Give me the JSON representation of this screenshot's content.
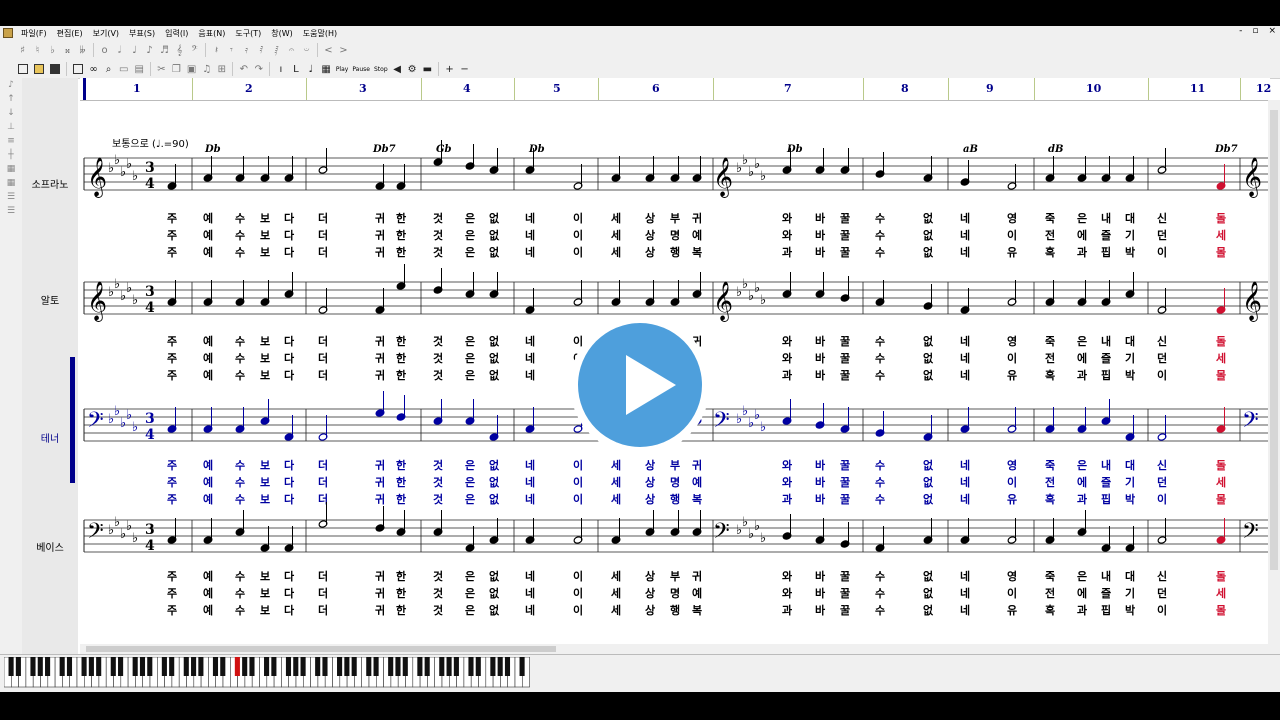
{
  "menu": [
    "파일(F)",
    "편집(E)",
    "보기(V)",
    "부표(S)",
    "입력(I)",
    "음표(N)",
    "도구(T)",
    "창(W)",
    "도움말(H)"
  ],
  "window_controls": [
    "-",
    "▫",
    "×"
  ],
  "toolbar1_icons": [
    "♯",
    "♮",
    "♭",
    "𝄪",
    "𝄫",
    "o",
    "𝅗𝅥",
    "♩",
    "♪",
    "♬",
    "𝄞",
    "𝄢",
    "𝄽",
    "𝄾",
    "𝄿",
    "𝅀",
    "𝅁",
    "𝄐",
    "𝄑",
    "<",
    ">"
  ],
  "toolbar2_icons": [
    "new-icon",
    "open-icon",
    "save-icon",
    "print-icon",
    "zoom-icon",
    "cut-icon",
    "copy-icon",
    "paste-icon",
    "undo-icon",
    "redo-icon"
  ],
  "transport": {
    "play": "Play",
    "pause": "Pause",
    "stop": "Stop"
  },
  "tempo_marking": "보통으로 (♩.=90)",
  "measures": [
    "1",
    "2",
    "3",
    "4",
    "5",
    "6",
    "7",
    "8",
    "9",
    "10",
    "11",
    "12"
  ],
  "chords": [
    {
      "label": "Db",
      "measure": 2
    },
    {
      "label": "Db7",
      "measure": 3
    },
    {
      "label": "Gb",
      "measure": 4
    },
    {
      "label": "Db",
      "measure": 5
    },
    {
      "label": "Db",
      "measure": 7
    },
    {
      "label": "aB",
      "measure": 9
    },
    {
      "label": "dB",
      "measure": 10
    },
    {
      "label": "Db7",
      "measure": 12
    }
  ],
  "time_signature": {
    "top": "3",
    "bottom": "4"
  },
  "parts": [
    {
      "name": "소프라노",
      "clef": "treble",
      "active": false,
      "color": "#000000"
    },
    {
      "name": "알토",
      "clef": "treble",
      "active": false,
      "color": "#000000"
    },
    {
      "name": "테너",
      "clef": "bass",
      "active": true,
      "color": "#0000a0"
    },
    {
      "name": "베이스",
      "clef": "bass",
      "active": false,
      "color": "#000000"
    }
  ],
  "lyrics": {
    "verse1": [
      "주",
      "예",
      "수",
      "보",
      "다",
      "더",
      "귀",
      "한",
      "것",
      "은",
      "없",
      "네",
      "이",
      "세",
      "상",
      "부",
      "귀",
      "와",
      "바",
      "꿀",
      "수",
      "없",
      "네",
      "영",
      "죽",
      "은",
      "내",
      "대",
      "신",
      "돌"
    ],
    "verse2": [
      "주",
      "예",
      "수",
      "보",
      "다",
      "더",
      "귀",
      "한",
      "것",
      "은",
      "없",
      "네",
      "이",
      "세",
      "상",
      "명",
      "예",
      "와",
      "바",
      "꿀",
      "수",
      "없",
      "네",
      "이",
      "전",
      "에",
      "즐",
      "기",
      "던",
      "세"
    ],
    "verse3": [
      "주",
      "예",
      "수",
      "보",
      "다",
      "더",
      "귀",
      "한",
      "것",
      "은",
      "없",
      "네",
      "이",
      "세",
      "상",
      "행",
      "복",
      "과",
      "바",
      "꿀",
      "수",
      "없",
      "네",
      "유",
      "혹",
      "과",
      "핍",
      "박",
      "이",
      "몰"
    ]
  },
  "colors": {
    "measure_line": "#00008b",
    "active_part": "#00008b",
    "highlight_note": "#d01030",
    "play_button": "#4e9fdc"
  }
}
